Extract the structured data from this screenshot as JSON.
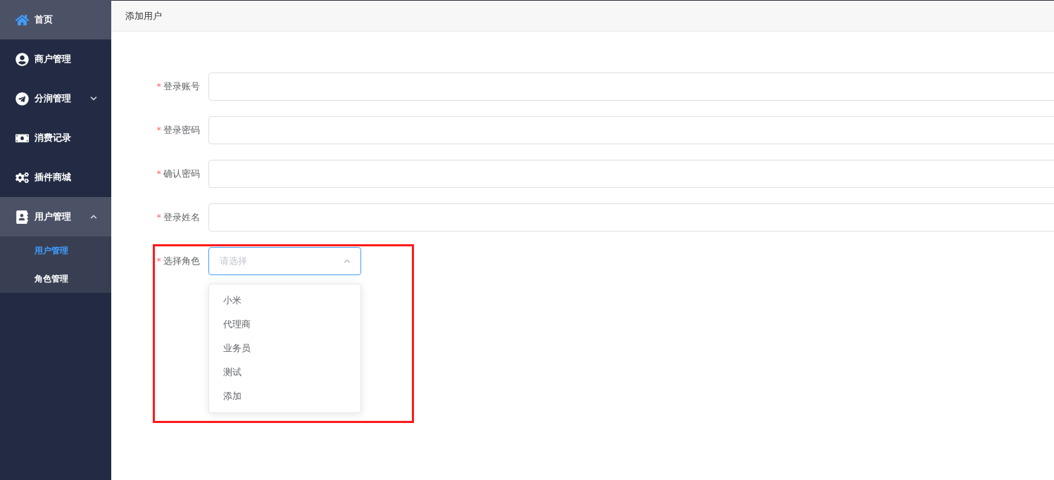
{
  "sidebar": {
    "items": [
      {
        "label": "首页",
        "selected": true
      },
      {
        "label": "商户管理",
        "selected": false
      },
      {
        "label": "分润管理",
        "selected": false,
        "expanded": false
      },
      {
        "label": "消费记录",
        "selected": false
      },
      {
        "label": "插件商城",
        "selected": false
      },
      {
        "label": "用户管理",
        "selected": false,
        "expanded": true,
        "children": [
          {
            "label": "用户管理",
            "selected": true
          },
          {
            "label": "角色管理",
            "selected": false
          }
        ]
      }
    ]
  },
  "page_title": "添加用户",
  "form": {
    "fields": [
      {
        "kind": "input",
        "label": "登录账号",
        "required_mark": "*"
      },
      {
        "kind": "input",
        "label": "登录密码",
        "required_mark": "*"
      },
      {
        "kind": "input",
        "label": "确认密码",
        "required_mark": "*"
      },
      {
        "kind": "input",
        "label": "登录姓名",
        "required_mark": "*"
      },
      {
        "kind": "select",
        "label": "选择角色",
        "required_mark": "*",
        "placeholder": "请选择",
        "expanded": true,
        "highlighted": true,
        "options": [
          {
            "label": "小米",
            "selected": false
          },
          {
            "label": "代理商",
            "selected": false
          },
          {
            "label": "业务员",
            "selected": false
          },
          {
            "label": "测试",
            "selected": false
          },
          {
            "label": "添加",
            "selected": false
          }
        ]
      }
    ]
  }
}
